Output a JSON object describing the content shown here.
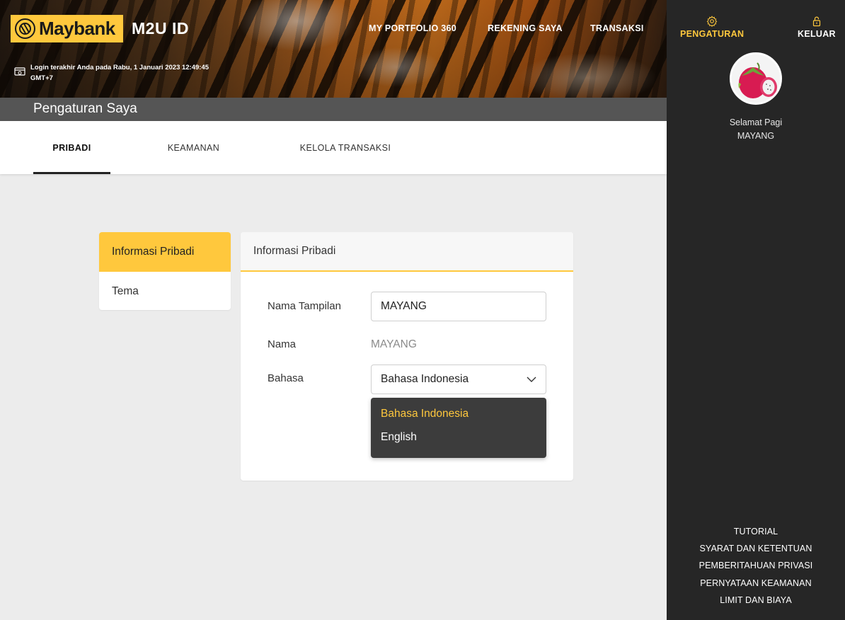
{
  "brand": {
    "logo_text": "Maybank",
    "app_name": "M2U ID",
    "accent_color": "#ffc83d"
  },
  "header": {
    "last_login_line1": "Login terakhir Anda pada Rabu, 1 Januari 2023 12:49:45",
    "last_login_line2": "GMT+7",
    "nav": [
      "MY PORTFOLIO 360",
      "REKENING SAYA",
      "TRANSAKSI"
    ]
  },
  "page": {
    "title": "Pengaturan Saya"
  },
  "tabs": [
    {
      "label": "PRIBADI",
      "active": true
    },
    {
      "label": "KEAMANAN",
      "active": false
    },
    {
      "label": "KELOLA TRANSAKSI",
      "active": false
    }
  ],
  "side_menu": [
    {
      "label": "Informasi Pribadi",
      "active": true
    },
    {
      "label": "Tema",
      "active": false
    }
  ],
  "card": {
    "title": "Informasi Pribadi",
    "display_name_label": "Nama Tampilan",
    "display_name_value": "MAYANG",
    "name_label": "Nama",
    "name_value": "MAYANG",
    "language_label": "Bahasa",
    "language_selected": "Bahasa Indonesia",
    "language_options": [
      "Bahasa Indonesia",
      "English"
    ]
  },
  "right_panel": {
    "settings_label": "PENGATURAN",
    "logout_label": "KELUAR",
    "greeting": "Selamat Pagi",
    "user_name": "MAYANG",
    "footer_links": [
      "TUTORIAL",
      "SYARAT DAN KETENTUAN",
      "PEMBERITAHUAN PRIVASI",
      "PERNYATAAN KEAMANAN",
      "LIMIT DAN BIAYA"
    ]
  },
  "icons": {
    "logo": "tiger-head-icon",
    "last_login": "login-history-icon",
    "settings": "gear-icon",
    "logout": "lock-icon",
    "select": "chevron-down-icon"
  }
}
